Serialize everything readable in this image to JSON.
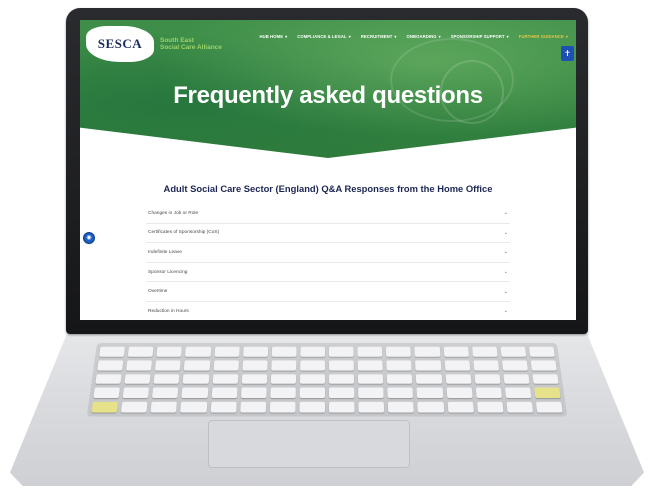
{
  "site": {
    "logo_text": "SESCA",
    "org_name_line1": "South East",
    "org_name_line2": "Social Care Alliance"
  },
  "nav": {
    "items": [
      {
        "label": "HUB HOME",
        "active": false
      },
      {
        "label": "COMPLIANCE & LEGAL",
        "active": false
      },
      {
        "label": "RECRUITMENT",
        "active": false
      },
      {
        "label": "ONBOARDING",
        "active": false
      },
      {
        "label": "SPONSORSHIP SUPPORT",
        "active": false
      },
      {
        "label": "FURTHER GUIDANCE",
        "active": true
      }
    ],
    "active_color": "#e6c64a"
  },
  "hero": {
    "title": "Frequently asked questions",
    "brand_color": "#3f8f4a"
  },
  "faq": {
    "heading": "Adult Social Care Sector (England) Q&A Responses from the Home Office",
    "items": [
      {
        "label": "Changes in Job or Role"
      },
      {
        "label": "Certificates of Sponsorship (CoS)"
      },
      {
        "label": "Indefinite Leave"
      },
      {
        "label": "Sponsor Licencing"
      },
      {
        "label": "Overtime"
      },
      {
        "label": "Reduction in Hours"
      }
    ],
    "expand_icon": "chevron-down-icon"
  },
  "widgets": {
    "accessibility_icon": "accessibility-icon",
    "side_icon": "chat-icon"
  }
}
